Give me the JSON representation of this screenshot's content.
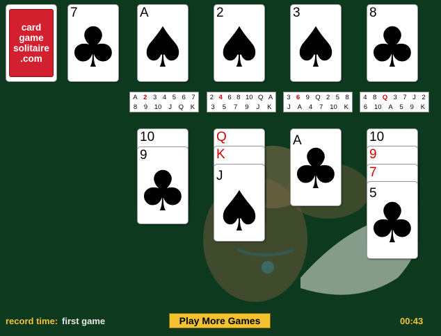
{
  "logo": {
    "lines": [
      "card",
      "game",
      "solitaire",
      ".com"
    ]
  },
  "waste_card": {
    "rank": "7",
    "suit": "clubs",
    "glyph": "♣"
  },
  "foundations": [
    {
      "rank": "A",
      "suit": "spades",
      "glyph": "♠"
    },
    {
      "rank": "2",
      "suit": "spades",
      "glyph": "♠"
    },
    {
      "rank": "3",
      "suit": "spades",
      "glyph": "♠"
    },
    {
      "rank": "8",
      "suit": "clubs",
      "glyph": "♣"
    }
  ],
  "trackers": [
    {
      "row1": [
        "A",
        "2",
        "3",
        "4",
        "5",
        "6",
        "7"
      ],
      "row2": [
        "8",
        "9",
        "10",
        "J",
        "Q",
        "K"
      ],
      "red": [
        1
      ]
    },
    {
      "row1": [
        "2",
        "4",
        "6",
        "8",
        "10",
        "Q",
        "A"
      ],
      "row2": [
        "3",
        "5",
        "7",
        "9",
        "J",
        "K"
      ],
      "red": [
        1
      ]
    },
    {
      "row1": [
        "3",
        "6",
        "9",
        "Q",
        "2",
        "5",
        "8"
      ],
      "row2": [
        "J",
        "A",
        "4",
        "7",
        "10",
        "K"
      ],
      "red": [
        1
      ]
    },
    {
      "row1": [
        "4",
        "8",
        "Q",
        "3",
        "7",
        "J",
        "2"
      ],
      "row2": [
        "6",
        "10",
        "A",
        "5",
        "9",
        "K"
      ],
      "red": [
        2
      ]
    }
  ],
  "tableau": {
    "col1": {
      "under": {
        "rank": "10"
      },
      "top": {
        "rank": "9",
        "suit": "clubs",
        "glyph": "♣"
      }
    },
    "col2": {
      "under1": {
        "rank": "Q"
      },
      "under2": {
        "rank": "K"
      },
      "top": {
        "rank": "J",
        "suit": "spades",
        "glyph": "♠"
      }
    },
    "col3": {
      "top": {
        "rank": "A",
        "suit": "clubs",
        "glyph": "♣"
      }
    },
    "col4": {
      "under1": {
        "rank": "10"
      },
      "under2": {
        "rank": "9"
      },
      "under3": {
        "rank": "7"
      },
      "top": {
        "rank": "5",
        "suit": "clubs",
        "glyph": "♣"
      }
    }
  },
  "footer": {
    "record_label": "record time:",
    "record_value": "first game",
    "play_button": "Play More Games",
    "timer": "00:43"
  },
  "colors": {
    "background": "#0d3a1f",
    "accent": "#f2c230",
    "red": "#d40000"
  }
}
